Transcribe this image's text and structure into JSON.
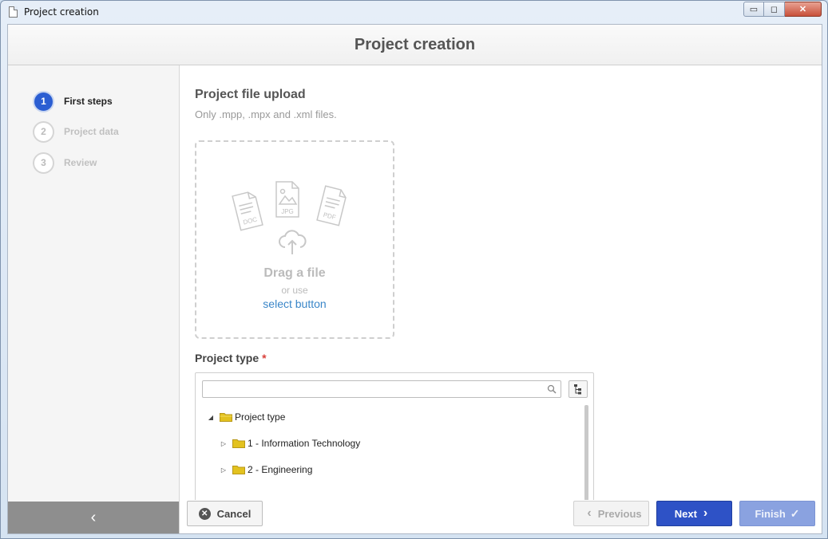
{
  "window": {
    "title": "Project creation",
    "controls": {
      "minimize": "▭",
      "maximize": "◻",
      "close": "✕"
    }
  },
  "header": {
    "title": "Project creation"
  },
  "sidebar": {
    "steps": [
      {
        "number": "1",
        "label": "First steps",
        "state": "active"
      },
      {
        "number": "2",
        "label": "Project data",
        "state": "inactive"
      },
      {
        "number": "3",
        "label": "Review",
        "state": "inactive"
      }
    ],
    "collapse_glyph": "‹"
  },
  "upload": {
    "title": "Project file upload",
    "subtitle": "Only .mpp, .mpx and .xml files.",
    "file_types": [
      "DOC",
      "JPG",
      "PDF"
    ],
    "drag_title": "Drag a file",
    "or_use": "or use",
    "select_link": "select button"
  },
  "project_type": {
    "label": "Project type",
    "required_mark": "*",
    "search": {
      "value": "",
      "placeholder": ""
    },
    "tree": [
      {
        "label": "Project type",
        "expanded": true,
        "level": 0
      },
      {
        "label": "1 - Information Technology",
        "expanded": false,
        "level": 1
      },
      {
        "label": "2 - Engineering",
        "expanded": false,
        "level": 1
      }
    ]
  },
  "footer": {
    "cancel_label": "Cancel",
    "previous_label": "Previous",
    "next_label": "Next",
    "finish_label": "Finish"
  },
  "colors": {
    "primary": "#2e52c6",
    "step_active": "#2b5ed2",
    "link": "#3a86c8",
    "required": "#d9403a",
    "folder": "#e3c21f"
  }
}
